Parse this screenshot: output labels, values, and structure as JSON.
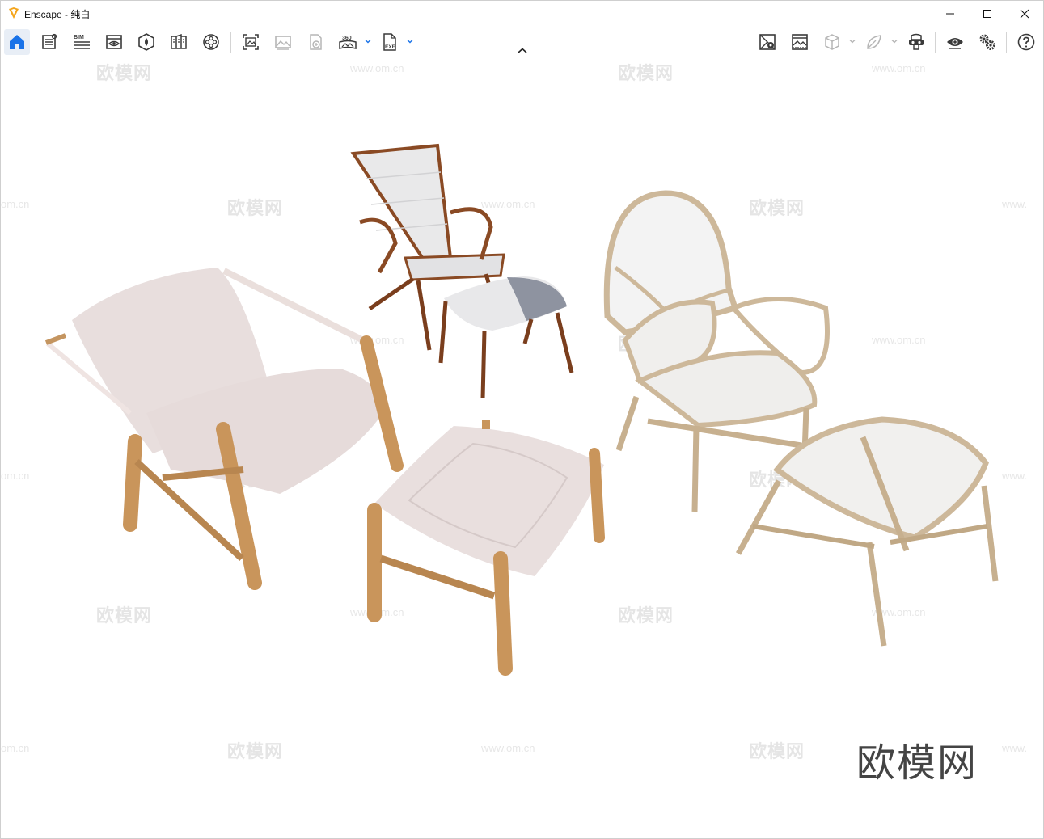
{
  "window": {
    "app_title": "Enscape",
    "separator": " - ",
    "scene_name": "纯白"
  },
  "toolbar": {
    "icons": [
      "home-icon",
      "asset-library-icon",
      "bim-icon",
      "visual-settings-icon",
      "materials-icon",
      "views-icon",
      "video-editor-icon",
      "screenshot-icon",
      "batch-render-icon",
      "upload-icon",
      "panorama-360-icon",
      "export-exe-icon",
      "site-context-icon",
      "atmosphere-icon",
      "cube-icon",
      "leaf-icon",
      "vr-headset-icon",
      "eye-icon",
      "settings-icon",
      "help-icon"
    ],
    "bim_label": "BIM",
    "pano_label": "360",
    "exe_label": "EXE"
  },
  "watermarks": {
    "brand": "欧模网",
    "url": "www.om.cn",
    "url_partial_left": "om.cn",
    "url_partial_right": "www."
  },
  "corner_watermark": "欧模网",
  "colors": {
    "accent": "#1a73e8",
    "logo_orange": "#f4a51c",
    "icon": "#3a3a3a",
    "icon_disabled": "#b5b5b5"
  }
}
